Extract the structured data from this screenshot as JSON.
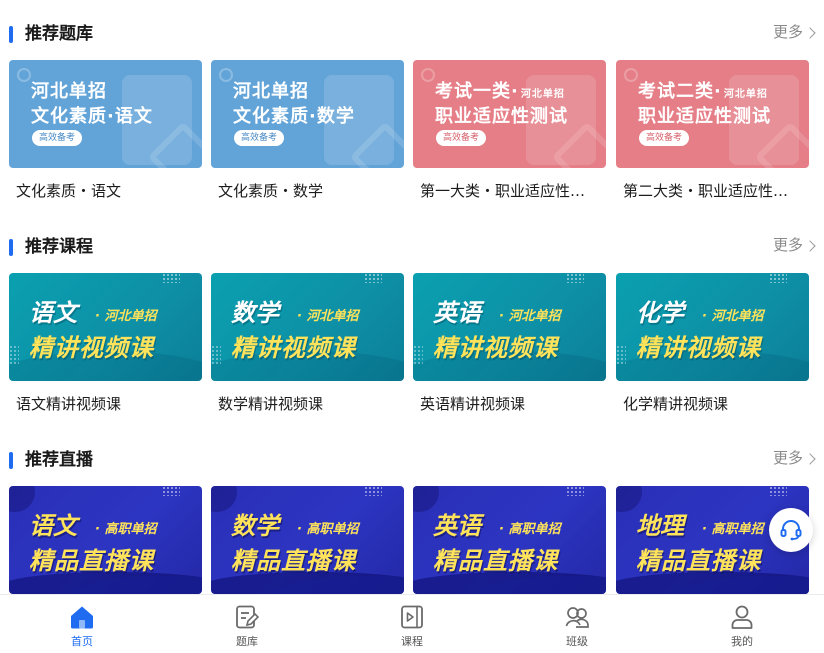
{
  "colors": {
    "accent": "#1f6cf0",
    "bank_blue": "#63a4d8",
    "bank_red": "#e57e86",
    "course_teal": "#0aa0b0",
    "live_indigo": "#2a2fb6"
  },
  "more_label": "更多",
  "sections": {
    "bank": {
      "title": "推荐题库",
      "cards": [
        {
          "line1": "河北单招",
          "line1_sub": "",
          "line2": "文化素质·语文",
          "pill": "高效备考",
          "caption": "文化素质・语文"
        },
        {
          "line1": "河北单招",
          "line1_sub": "",
          "line2": "文化素质·数学",
          "pill": "高效备考",
          "caption": "文化素质・数学"
        },
        {
          "line1": "考试一类·",
          "line1_sub": "河北单招",
          "line2": "职业适应性测试",
          "pill": "高效备考",
          "caption": "第一大类・职业适应性测试"
        },
        {
          "line1": "考试二类·",
          "line1_sub": "河北单招",
          "line2": "职业适应性测试",
          "pill": "高效备考",
          "caption": "第二大类・职业适应性测试"
        }
      ]
    },
    "course": {
      "title": "推荐课程",
      "cards": [
        {
          "subject": "语文",
          "tag": "· 河北单招",
          "line2": "精讲视频课",
          "caption": "语文精讲视频课"
        },
        {
          "subject": "数学",
          "tag": "· 河北单招",
          "line2": "精讲视频课",
          "caption": "数学精讲视频课"
        },
        {
          "subject": "英语",
          "tag": "· 河北单招",
          "line2": "精讲视频课",
          "caption": "英语精讲视频课"
        },
        {
          "subject": "化学",
          "tag": "· 河北单招",
          "line2": "精讲视频课",
          "caption": "化学精讲视频课"
        }
      ]
    },
    "live": {
      "title": "推荐直播",
      "cards": [
        {
          "subject": "语文",
          "tag": "· 高职单招",
          "line2": "精品直播课"
        },
        {
          "subject": "数学",
          "tag": "· 高职单招",
          "line2": "精品直播课"
        },
        {
          "subject": "英语",
          "tag": "· 高职单招",
          "line2": "精品直播课"
        },
        {
          "subject": "地理",
          "tag": "· 高职单招",
          "line2": "精品直播课"
        }
      ]
    }
  },
  "tabbar": [
    {
      "label": "首页",
      "icon": "home-icon",
      "active": true
    },
    {
      "label": "题库",
      "icon": "question-bank-icon",
      "active": false
    },
    {
      "label": "课程",
      "icon": "course-video-icon",
      "active": false
    },
    {
      "label": "班级",
      "icon": "class-group-icon",
      "active": false
    },
    {
      "label": "我的",
      "icon": "profile-icon",
      "active": false
    }
  ],
  "fab_icon": "customer-service-icon"
}
